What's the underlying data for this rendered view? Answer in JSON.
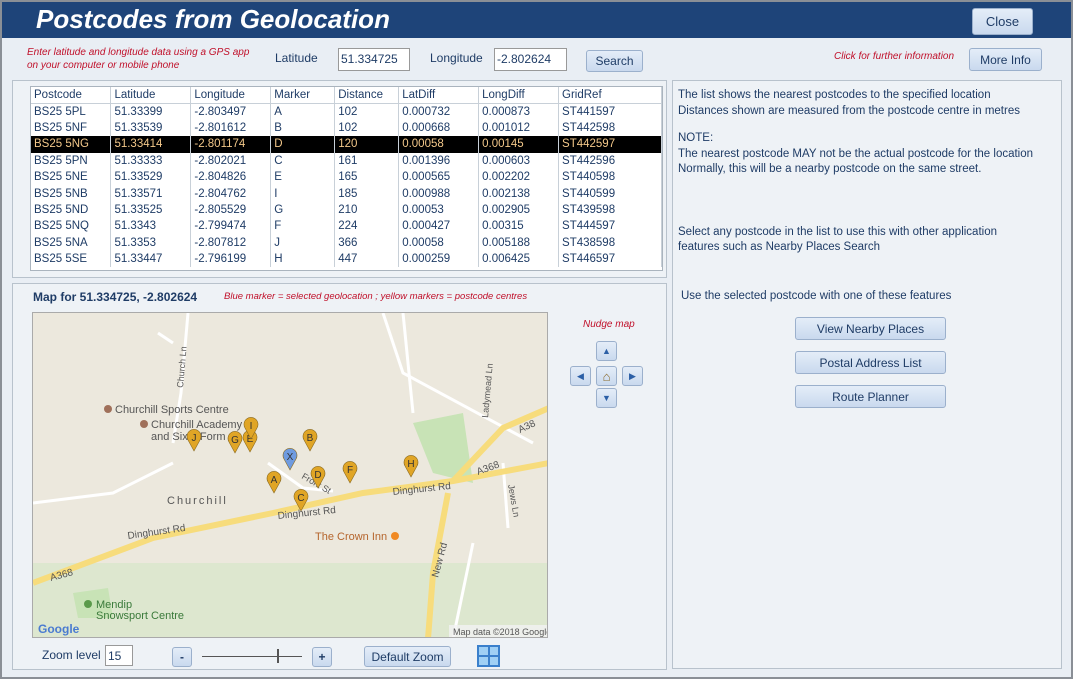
{
  "window": {
    "title": "Postcodes from Geolocation",
    "close_label": "Close"
  },
  "search": {
    "instructions_line1": "Enter latitude and longitude data using a GPS app",
    "instructions_line2": "on your computer or mobile phone",
    "latitude_label": "Latitude",
    "latitude_value": "51.334725",
    "longitude_label": "Longitude",
    "longitude_value": "-2.802624",
    "search_label": "Search",
    "info_hint": "Click for further information",
    "more_info_label": "More Info"
  },
  "table": {
    "columns": [
      "Postcode",
      "Latitude",
      "Longitude",
      "Marker",
      "Distance",
      "LatDiff",
      "LongDiff",
      "GridRef"
    ],
    "selected_index": 2,
    "rows": [
      [
        "BS25 5PL",
        "51.33399",
        "-2.803497",
        "A",
        "102",
        "0.000732",
        "0.000873",
        "ST441597"
      ],
      [
        "BS25 5NF",
        "51.33539",
        "-2.801612",
        "B",
        "102",
        "0.000668",
        "0.001012",
        "ST442598"
      ],
      [
        "BS25 5NG",
        "51.33414",
        "-2.801174",
        "D",
        "120",
        "0.00058",
        "0.00145",
        "ST442597"
      ],
      [
        "BS25 5PN",
        "51.33333",
        "-2.802021",
        "C",
        "161",
        "0.001396",
        "0.000603",
        "ST442596"
      ],
      [
        "BS25 5NE",
        "51.33529",
        "-2.804826",
        "E",
        "165",
        "0.000565",
        "0.002202",
        "ST440598"
      ],
      [
        "BS25 5NB",
        "51.33571",
        "-2.804762",
        "I",
        "185",
        "0.000988",
        "0.002138",
        "ST440599"
      ],
      [
        "BS25 5ND",
        "51.33525",
        "-2.805529",
        "G",
        "210",
        "0.00053",
        "0.002905",
        "ST439598"
      ],
      [
        "BS25 5NQ",
        "51.3343",
        "-2.799474",
        "F",
        "224",
        "0.000427",
        "0.00315",
        "ST444597"
      ],
      [
        "BS25 5NA",
        "51.3353",
        "-2.807812",
        "J",
        "366",
        "0.00058",
        "0.005188",
        "ST438598"
      ],
      [
        "BS25 5SE",
        "51.33447",
        "-2.796199",
        "H",
        "447",
        "0.000259",
        "0.006425",
        "ST446597"
      ]
    ]
  },
  "map": {
    "title": "Map for 51.334725, -2.802624",
    "legend": "Blue marker = selected geolocation ; yellow markers = postcode centres",
    "nudge_label": "Nudge map",
    "labels": {
      "sports": "Churchill Sports Centre",
      "academy1": "Churchill Academy",
      "academy2": "and Sixth Form",
      "village": "Churchill",
      "dinghurst1": "Dinghurst Rd",
      "dinghurst2": "Dinghurst Rd",
      "dinghurst3": "Dinghurst Rd",
      "a368a": "A368",
      "a368b": "A368",
      "a38": "A38",
      "church": "Church Ln",
      "ladymead": "Ladymead Ln",
      "front": "Front St",
      "jews": "Jews Ln",
      "newrd": "New Rd",
      "crown": "The Crown Inn",
      "mendip1": "Mendip",
      "mendip2": "Snowsport Centre",
      "google": "Google",
      "copyright": "Map data ©2018 Google"
    },
    "selected_marker": "X",
    "marker_letters": [
      "A",
      "B",
      "C",
      "D",
      "E",
      "F",
      "G",
      "H",
      "I",
      "J"
    ],
    "zoom_label": "Zoom level",
    "zoom_value": "15",
    "zoom_fraction": 0.75,
    "zoom_out": "-",
    "zoom_in": "+",
    "default_zoom_label": "Default Zoom"
  },
  "info": {
    "line1": "The list shows the nearest postcodes to the specified location",
    "line2": "Distances shown are measured from the postcode centre in metres",
    "note_title": "NOTE:",
    "note1": "The nearest postcode MAY not be the actual postcode for the location",
    "note2": "Normally, this will be a nearby postcode on the same street.",
    "select1": "Select any postcode in the list to use this with other application",
    "select2": "features such as Nearby Places Search",
    "features_title": "Use the selected postcode with one of these features",
    "btn_nearby": "View Nearby Places",
    "btn_postal": "Postal Address List",
    "btn_route": "Route Planner"
  },
  "colors": {
    "header": "#1e4479",
    "marker_yellow": "#e0a526",
    "marker_blue": "#6f9be0"
  }
}
